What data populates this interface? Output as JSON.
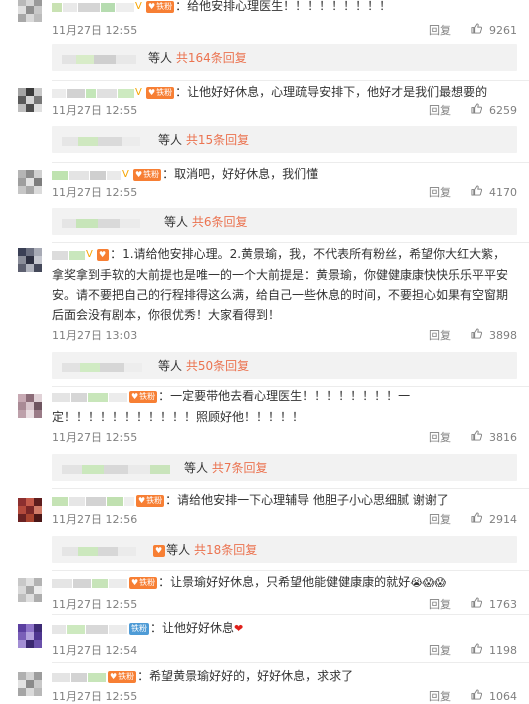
{
  "comments": [
    {
      "text": "：给他安排心理医生！！！！！！！！！",
      "time": "11月27日 12:55",
      "likes": "9261"
    },
    {
      "text": "：让他好好休息，心理疏导安排下，他好才是我们最想要的",
      "time": "11月27日 12:55",
      "likes": "6259"
    },
    {
      "text": "：取消吧，好好休息，我们懂",
      "time": "11月27日 12:55",
      "likes": "4170"
    },
    {
      "text": "：1.请给他安排心理。2.黄景瑜，我，不代表所有粉丝，希望你大红大紫，拿奖拿到手软的大前提也是唯一的一个大前提是：黄景瑜，你健健康康快快乐乐平平安安。请不要把自己的行程排得这么满，给自己一些休息的时间，不要担心如果有空窗期后面会没有剧本，你很优秀！大家看得到！",
      "time": "11月27日 13:03",
      "likes": "3898"
    },
    {
      "text": "：一定要带他去看心理医生！！！！！！！！一定！！！！！！！！！！！照顾好他！！！！！",
      "time": "11月27日 12:55",
      "likes": "3816"
    },
    {
      "text": "：请给他安排一下心理辅导 他胆子小心思细腻 谢谢了",
      "time": "11月27日 12:56",
      "likes": "2914"
    },
    {
      "text": "：让景瑜好好休息，只希望他能健健康康的就好",
      "emojis": "😭😱😱",
      "time": "11月27日 12:55",
      "likes": "1763"
    },
    {
      "text": "：让他好好休息",
      "emojis": "❤",
      "time": "11月27日 12:54",
      "likes": "1198"
    },
    {
      "text": "：希望黄景瑜好好的，好好休息，求求了",
      "time": "11月27日 12:55",
      "likes": "1064"
    }
  ],
  "replies": [
    {
      "prefix": "等人",
      "count": "共164条回复"
    },
    {
      "prefix": "等人",
      "count": "共15条回复"
    },
    {
      "prefix": "等人",
      "count": "共6条回复"
    },
    {
      "prefix": "等人",
      "count": "共50条回复"
    },
    {
      "prefix": "等人",
      "count": "共7条回复"
    },
    {
      "prefix": "等人",
      "count": "共18条回复"
    }
  ],
  "labels": {
    "reply": "回复",
    "fan_badge": "铁粉",
    "vip_mark": "V"
  },
  "icons": {
    "like": "thumbs-up-icon",
    "heart": "heart-icon"
  },
  "colors": {
    "accent": "#eb7350",
    "fan_badge": "#f77f34",
    "fan_badge_blue": "#4e9bd6",
    "meta": "#808080",
    "reply_bg": "#f2f2f2"
  }
}
